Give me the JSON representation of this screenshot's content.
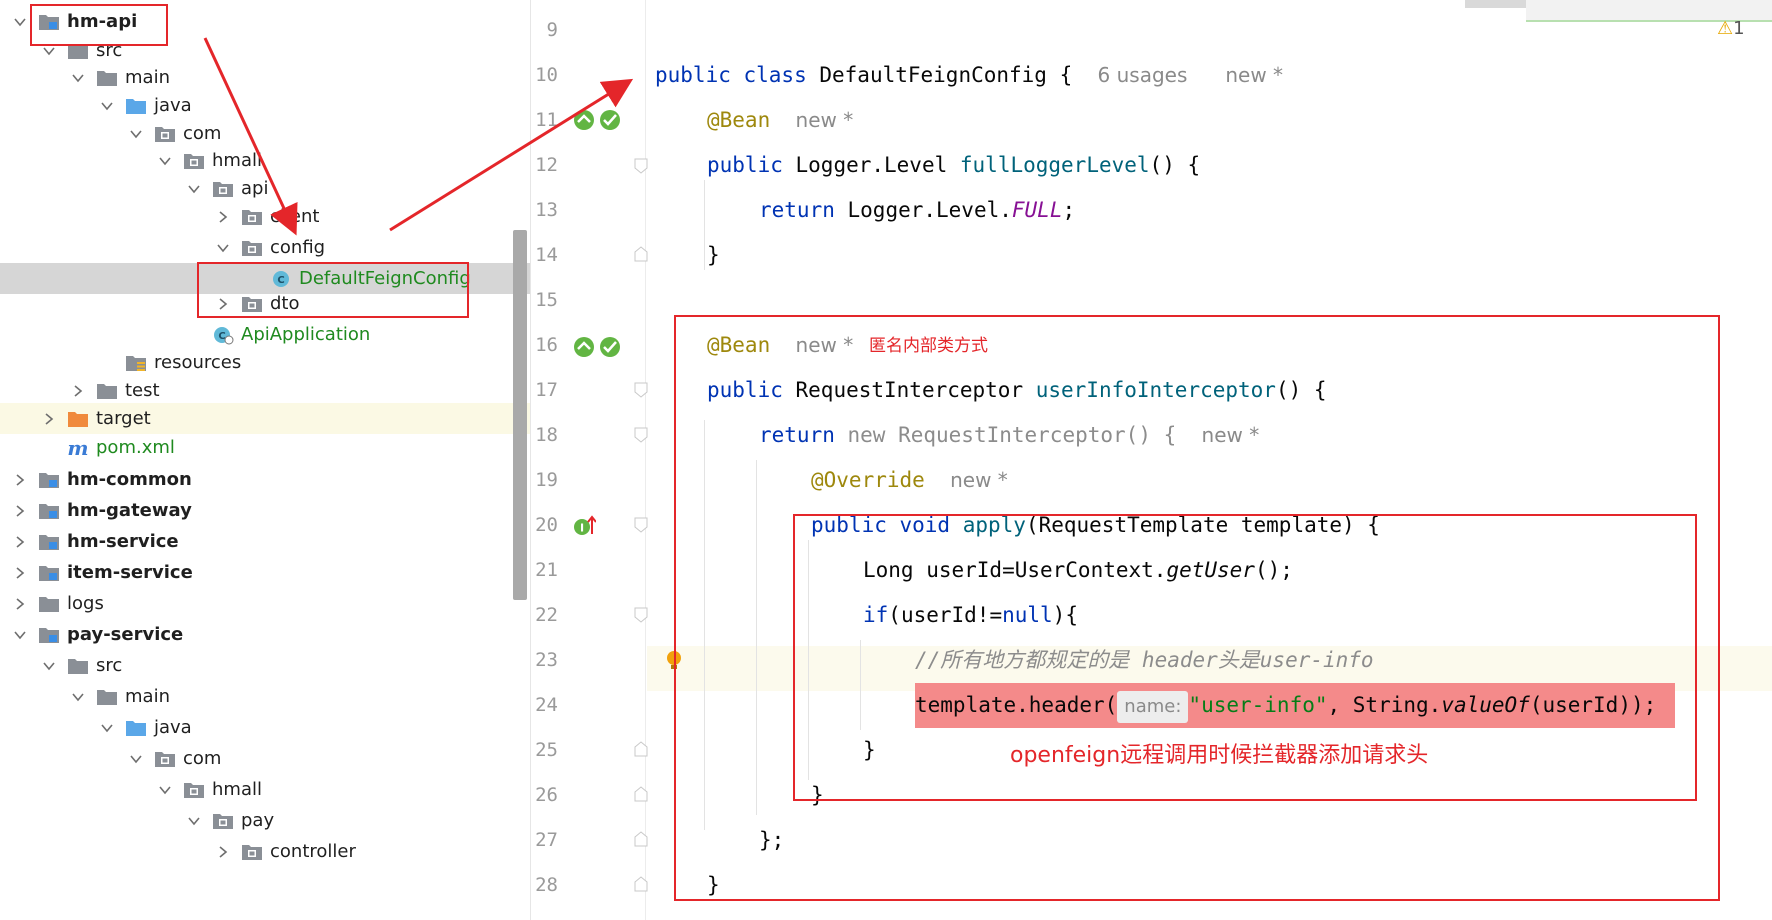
{
  "tree": {
    "items": [
      {
        "label": "hm-api",
        "icon": "module-folder-icon",
        "bold": true,
        "expanded": true
      },
      {
        "label": "src",
        "icon": "folder-icon",
        "expanded": true
      },
      {
        "label": "main",
        "icon": "folder-icon",
        "expanded": true
      },
      {
        "label": "java",
        "icon": "source-folder-icon",
        "expanded": true
      },
      {
        "label": "com",
        "icon": "package-icon",
        "expanded": true
      },
      {
        "label": "hmall",
        "icon": "package-icon",
        "expanded": true
      },
      {
        "label": "api",
        "icon": "package-icon",
        "expanded": true
      },
      {
        "label": "client",
        "icon": "package-icon",
        "expanded": false
      },
      {
        "label": "config",
        "icon": "package-icon",
        "expanded": true
      },
      {
        "label": "DefaultFeignConfig",
        "icon": "class-icon",
        "selected": true
      },
      {
        "label": "dto",
        "icon": "package-icon",
        "expanded": false
      },
      {
        "label": "ApiApplication",
        "icon": "spring-class-icon"
      },
      {
        "label": "resources",
        "icon": "resources-folder-icon"
      },
      {
        "label": "test",
        "icon": "folder-icon",
        "expanded": false
      },
      {
        "label": "target",
        "icon": "excluded-folder-icon",
        "expanded": false
      },
      {
        "label": "pom.xml",
        "icon": "maven-icon"
      },
      {
        "label": "hm-common",
        "icon": "module-folder-icon",
        "bold": true,
        "expanded": false
      },
      {
        "label": "hm-gateway",
        "icon": "module-folder-icon",
        "bold": true,
        "expanded": false
      },
      {
        "label": "hm-service",
        "icon": "module-folder-icon",
        "bold": true,
        "expanded": false
      },
      {
        "label": "item-service",
        "icon": "module-folder-icon",
        "bold": true,
        "expanded": false
      },
      {
        "label": "logs",
        "icon": "folder-icon",
        "expanded": false
      },
      {
        "label": "pay-service",
        "icon": "module-folder-icon",
        "bold": true,
        "expanded": true
      },
      {
        "label": "src",
        "icon": "folder-icon",
        "expanded": true
      },
      {
        "label": "main",
        "icon": "folder-icon",
        "expanded": true
      },
      {
        "label": "java",
        "icon": "source-folder-icon",
        "expanded": true
      },
      {
        "label": "com",
        "icon": "package-icon",
        "expanded": true
      },
      {
        "label": "hmall",
        "icon": "package-icon",
        "expanded": true
      },
      {
        "label": "pay",
        "icon": "package-icon",
        "expanded": true
      },
      {
        "label": "controller",
        "icon": "package-icon",
        "expanded": false
      }
    ],
    "maven_glyph": "m"
  },
  "editor": {
    "line_numbers": [
      "9",
      "10",
      "11",
      "12",
      "13",
      "14",
      "15",
      "16",
      "17",
      "18",
      "19",
      "20",
      "21",
      "22",
      "23",
      "24",
      "25",
      "26",
      "27",
      "28"
    ],
    "warning_count": "1",
    "code": {
      "l10": {
        "kw": "public class ",
        "name": "DefaultFeignConfig {",
        "usages": "6 usages",
        "new": "new *"
      },
      "l11": {
        "ann": "@Bean",
        "new": "new *"
      },
      "l12": {
        "kw": "public ",
        "type": "Logger.Level ",
        "fn": "fullLoggerLevel",
        "rest": "() {"
      },
      "l13": {
        "kw": "return ",
        "type": "Logger.Level.",
        "const": "FULL",
        "rest": ";"
      },
      "l14": {
        "text": "}"
      },
      "l16": {
        "ann": "@Bean",
        "new": "new *"
      },
      "l17": {
        "kw": "public ",
        "type": "RequestInterceptor ",
        "fn": "userInfoInterceptor",
        "rest": "() {"
      },
      "l18": {
        "kw": "return ",
        "kw2": "new ",
        "type": "RequestInterceptor",
        "rest": "() {",
        "new": "new *"
      },
      "l19": {
        "ann": "@Override",
        "new": "new *"
      },
      "l20": {
        "kw": "public void ",
        "fn": "apply",
        "rest": "(RequestTemplate template) {"
      },
      "l21": {
        "pre": "Long userId=UserContext.",
        "it": "getUser",
        "rest": "();"
      },
      "l22": {
        "kw": "if",
        "mid": "(userId!=",
        "kw2": "null",
        "rest": "){"
      },
      "l23": {
        "comment": "//所有地方都规定的是 header头是user-info"
      },
      "l24": {
        "pre": "template.header(",
        "hint": "name:",
        "str": "\"user-info\"",
        "mid": ", String.",
        "it": "valueOf",
        "rest": "(userId));"
      },
      "l25": {
        "text": "}"
      },
      "l26": {
        "text": "}"
      },
      "l27": {
        "text": "};"
      },
      "l28": {
        "text": "}"
      }
    }
  },
  "annotations": {
    "anon_class_note": "匿名内部类方式",
    "interceptor_note": "openfeign远程调用时候拦截器添加请求头",
    "color": "#e4262a"
  }
}
